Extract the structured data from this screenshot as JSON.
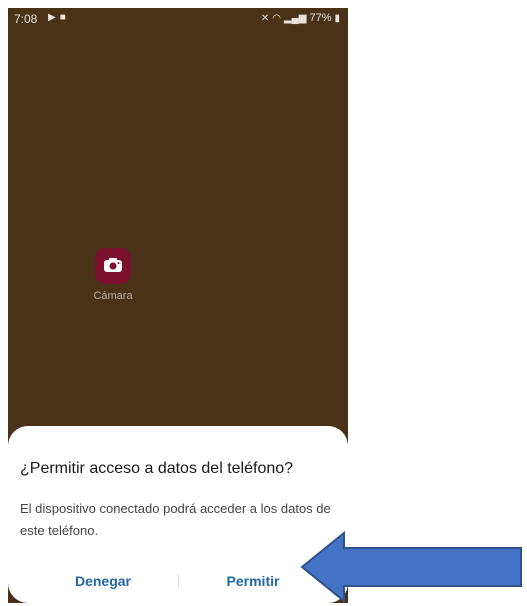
{
  "status_bar": {
    "time": "7:08",
    "left_icons": [
      "play-icon",
      "gallery-icon"
    ],
    "battery": "77%",
    "right_icons": [
      "mute-icon",
      "wifi-icon",
      "signal-icon",
      "battery-icon"
    ]
  },
  "home": {
    "app_label": "Cámara",
    "app_icon": "camera-icon"
  },
  "dialog": {
    "title": "¿Permitir acceso a datos del teléfono?",
    "body": "El dispositivo conectado podrá acceder a los datos de este teléfono.",
    "deny_label": "Denegar",
    "allow_label": "Permitir",
    "button_color": "#2169a5"
  },
  "annotation": {
    "arrow_color": "#4472c4",
    "arrow_outline": "#2f528f"
  }
}
